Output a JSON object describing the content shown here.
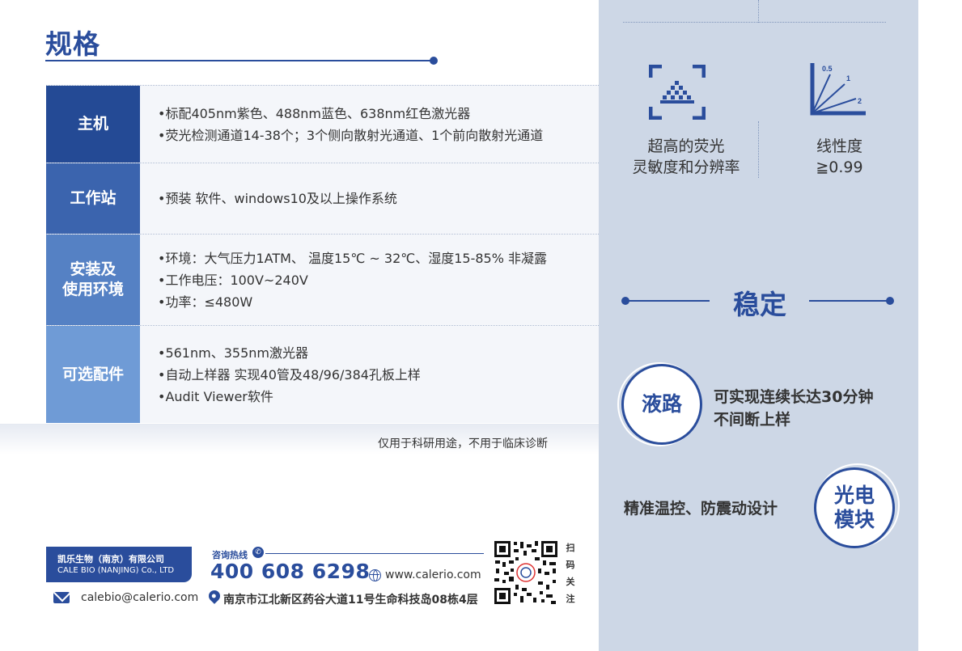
{
  "section_title": "规格",
  "specs": [
    {
      "label_lines": [
        "主机"
      ],
      "items": [
        "•标配405nm紫色、488nm蓝色、638nm红色激光器",
        "•荧光检测通道14-38个；3个侧向散射光通道、1个前向散射光通道"
      ]
    },
    {
      "label_lines": [
        "工作站"
      ],
      "items": [
        "•预装   软件、windows10及以上操作系统"
      ]
    },
    {
      "label_lines": [
        "安装及",
        "使用环境"
      ],
      "items": [
        "•环境：大气压力1ATM、 温度15℃ ~ 32℃、湿度15-85% 非凝露",
        "•工作电压：100V~240V",
        "•功率：≤480W"
      ]
    },
    {
      "label_lines": [
        "可选配件"
      ],
      "items": [
        "•561nm、355nm激光器",
        "•自动上样器   实现40管及48/96/384孔板上样",
        "•Audit Viewer软件"
      ]
    }
  ],
  "note": "仅用于科研用途，不用于临床诊断",
  "footer": {
    "company_cn": "凯乐生物（南京）有限公司",
    "company_en": "CALE BIO (NANJING) Co., LTD",
    "hotline_label": "咨询热线",
    "hotline": "400 608 6298",
    "website": "www.calerio.com",
    "email": "calebio@calerio.com",
    "address": "南京市江北新区药谷大道11号生命科技岛08栋4层",
    "qr_caption": [
      "扫",
      "码",
      "关",
      "注"
    ]
  },
  "panel": {
    "feature1_lines": [
      "超高的荧光",
      "灵敏度和分辨率"
    ],
    "feature2_lines": [
      "线性度",
      "≧0.99"
    ],
    "linearity_labels": [
      "0.5",
      "1",
      "2"
    ],
    "stable_title": "稳定",
    "circle1_label": "液路",
    "circle1_desc": [
      "可实现连续长达30分钟",
      "不间断上样"
    ],
    "circle2_label_lines": [
      "光电",
      "模块"
    ],
    "circle2_desc": "精准温控、防震动设计"
  },
  "colors": {
    "primary": "#2a4d9c",
    "panel_bg": "#cdd7e6"
  },
  "icons": [
    "phone-icon",
    "globe-icon",
    "mail-icon",
    "location-pin-icon",
    "scan-frame-icon",
    "linearity-icon",
    "qr-code"
  ]
}
